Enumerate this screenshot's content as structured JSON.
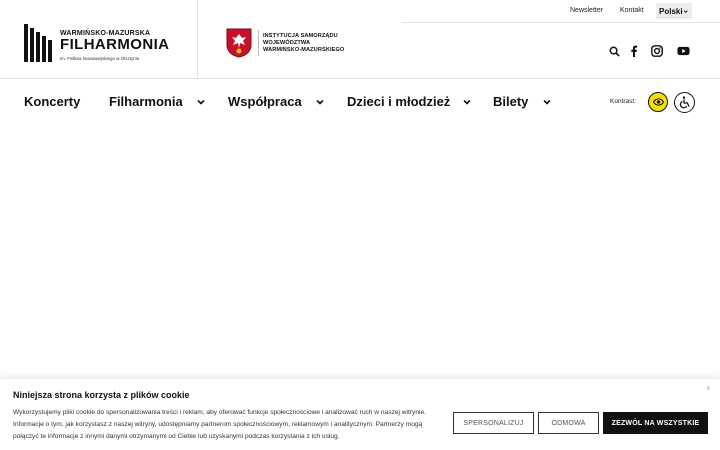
{
  "header": {
    "logo": {
      "top_line": "WARMIŃSKO-MAZURSKA",
      "main": "FILHARMONIA",
      "sub": "im. Feliksa Nowowiejskiego w Olsztynie"
    },
    "institution": {
      "lines": [
        "INSTYTUCJA SAMORZĄDU",
        "WOJEWÓDZTWA",
        "WARMIŃSKO-MAZURSKIEGO"
      ]
    },
    "top_links": {
      "newsletter": "Newsletter",
      "contact": "Kontakt"
    },
    "language": {
      "selected": "Polski"
    },
    "social_icons": [
      "search-icon",
      "facebook-icon",
      "instagram-icon",
      "youtube-icon"
    ]
  },
  "nav": {
    "items": [
      {
        "label": "Koncerty",
        "has_dropdown": false
      },
      {
        "label": "Filharmonia",
        "has_dropdown": true
      },
      {
        "label": "Współpraca",
        "has_dropdown": true
      },
      {
        "label": "Dzieci i młodzież",
        "has_dropdown": true
      },
      {
        "label": "Bilety",
        "has_dropdown": true
      }
    ],
    "contrast_label": "Kontrast:"
  },
  "colors": {
    "contrast_button": "#f3e000",
    "crest_red": "#c8102e",
    "dark": "#111111"
  },
  "cookie": {
    "title": "Niniejsza strona korzysta z plików cookie",
    "body": "Wykorzystujemy pliki cookie do spersonalizowania treści i reklam, aby oferować funkcje społecznościowe i analizować ruch w naszej witrynie. Informacje o tym, jak korzystasz z naszej witryny, udostępniamy partnerom społecznościowym, reklamowym i analitycznym. Partnerzy mogą połączyć te informacje z innymi danymi otrzymanymi od Ciebie lub uzyskanymi podczas korzystania z ich usług.",
    "close": "×",
    "buttons": {
      "customize": "SPERSONALIZUJ",
      "reject": "ODMOWA",
      "accept": "ZEZWÓL NA WSZYSTKIE"
    }
  }
}
